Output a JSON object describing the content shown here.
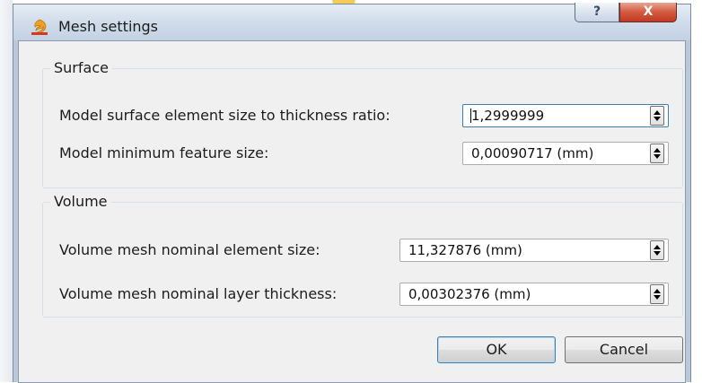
{
  "window": {
    "title": "Mesh settings",
    "help_glyph": "?",
    "close_glyph": "X",
    "icon": "app-logo-icon"
  },
  "surface": {
    "legend": "Surface",
    "ratio_label": "Model surface element size to thickness ratio:",
    "ratio_value": "1,2999999",
    "min_feature_label": "Model minimum feature size:",
    "min_feature_value": "0,00090717 (mm)"
  },
  "volume": {
    "legend": "Volume",
    "element_size_label": "Volume mesh nominal element size:",
    "element_size_value": "11,327876 (mm)",
    "layer_thickness_label": "Volume mesh nominal layer thickness:",
    "layer_thickness_value": "0,00302376 (mm)"
  },
  "buttons": {
    "ok": "OK",
    "cancel": "Cancel"
  },
  "colors": {
    "title_bar": "#cfdbe9",
    "close_button": "#c9472d",
    "dialog_body": "#f0f0f0",
    "focus_border": "#3c7fb1"
  }
}
